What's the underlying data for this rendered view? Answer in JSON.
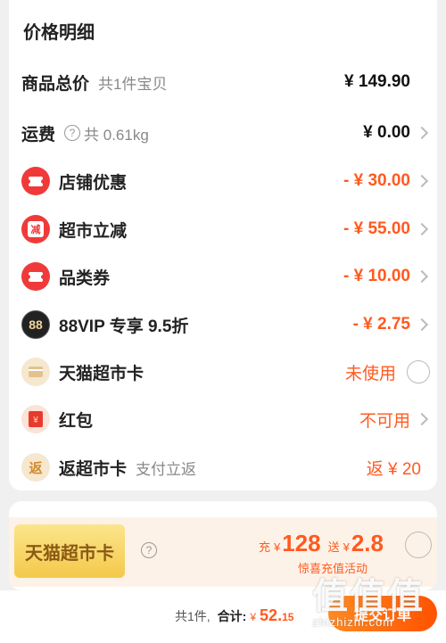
{
  "price_detail": {
    "title": "价格明细",
    "rows": [
      {
        "label": "商品总价",
        "sub": "共1件宝贝",
        "value": "¥ 149.90"
      },
      {
        "label": "运费",
        "sub": "共 0.61kg",
        "value": "¥ 0.00"
      },
      {
        "label": "店铺优惠",
        "value": "- ¥ 30.00",
        "icon": "coupon-ticket-icon"
      },
      {
        "label": "超市立减",
        "value": "- ¥ 55.00",
        "icon": "instant-discount-icon",
        "icon_text": "减"
      },
      {
        "label": "品类券",
        "value": "- ¥ 10.00",
        "icon": "coupon-ticket-icon"
      },
      {
        "label": "88VIP 专享 9.5折",
        "value": "- ¥ 2.75",
        "icon": "88vip-icon",
        "icon_text": "88"
      },
      {
        "label": "天猫超市卡",
        "value": "未使用",
        "icon": "membership-card-icon"
      },
      {
        "label": "红包",
        "value": "不可用",
        "icon": "red-envelope-icon",
        "icon_text": "¥"
      },
      {
        "label": "返超市卡",
        "sub": "支付立返",
        "value": "返 ¥ 20",
        "icon": "cashback-icon",
        "icon_text": "返"
      }
    ]
  },
  "promo": {
    "badge": "天猫超市卡",
    "charge_label": "充",
    "charge_currency": "¥",
    "charge_amount": "128",
    "gift_label": "送",
    "gift_currency": "¥",
    "gift_amount": "2.8",
    "subtitle": "惊喜充值活动"
  },
  "footer": {
    "count": "共1件,",
    "total_label": "合计:",
    "currency": "¥",
    "amount": "52.",
    "cents": "15",
    "submit_label": "提交订单"
  },
  "watermark": {
    "big": "值值值",
    "small": "zhizhizhi.com"
  },
  "colors": {
    "accent": "#ff5a1f",
    "icon_red": "#f03a3a",
    "promo_bg": "#fdf2e8"
  }
}
